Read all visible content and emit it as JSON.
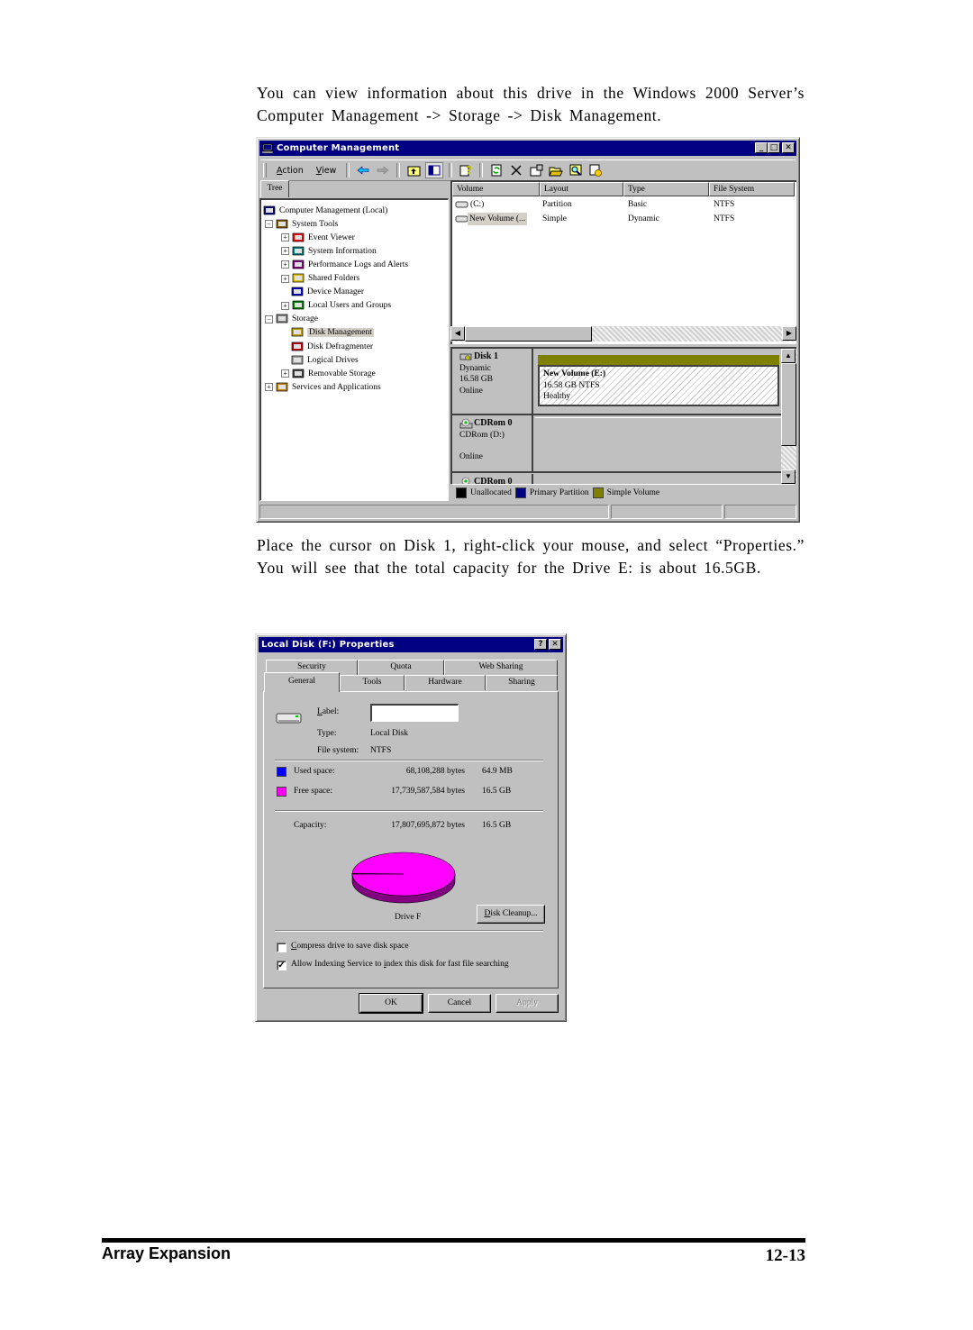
{
  "document": {
    "paragraph1": "You can view information about this drive in the Windows 2000 Server’s Computer Management -> Storage -> Disk Management.",
    "paragraph2": "Place the cursor on Disk 1, right-click your mouse, and select “Properties.” You will see that the total capacity for the Drive E: is about 16.5GB.",
    "footer": {
      "section": "Array Expansion",
      "page": "12-13"
    }
  },
  "computer_management": {
    "title": "Computer Management",
    "window_buttons": {
      "minimize": "_",
      "maximize": "□",
      "close": "✕"
    },
    "menu": {
      "action_u": "A",
      "action_rest": "ction",
      "view_u": "V",
      "view_rest": "iew"
    },
    "toolbar_icons": [
      "back-icon",
      "forward-icon",
      "up-folder-icon",
      "show-hide-tree-icon",
      "help-icon",
      "refresh-icon",
      "delete-icon",
      "properties-icon",
      "open-icon",
      "search-icon",
      "settings-icon"
    ],
    "tree_tab": "Tree",
    "tree": [
      {
        "label": "Computer Management (Local)",
        "level": 0,
        "expander": ""
      },
      {
        "label": "System Tools",
        "level": 1,
        "expander": "−"
      },
      {
        "label": "Event Viewer",
        "level": 2,
        "expander": "+"
      },
      {
        "label": "System Information",
        "level": 2,
        "expander": "+"
      },
      {
        "label": "Performance Logs and Alerts",
        "level": 2,
        "expander": "+"
      },
      {
        "label": "Shared Folders",
        "level": 2,
        "expander": "+"
      },
      {
        "label": "Device Manager",
        "level": 2,
        "expander": ""
      },
      {
        "label": "Local Users and Groups",
        "level": 2,
        "expander": "+"
      },
      {
        "label": "Storage",
        "level": 1,
        "expander": "−"
      },
      {
        "label": "Disk Management",
        "level": 2,
        "expander": "",
        "selected": true
      },
      {
        "label": "Disk Defragmenter",
        "level": 2,
        "expander": ""
      },
      {
        "label": "Logical Drives",
        "level": 2,
        "expander": ""
      },
      {
        "label": "Removable Storage",
        "level": 2,
        "expander": "+"
      },
      {
        "label": "Services and Applications",
        "level": 1,
        "expander": "+"
      }
    ],
    "volume_list": {
      "columns": [
        "Volume",
        "Layout",
        "Type",
        "File System"
      ],
      "rows": [
        {
          "volume": "(C:)",
          "layout": "Partition",
          "type": "Basic",
          "fs": "NTFS"
        },
        {
          "volume": "New Volume (...",
          "layout": "Simple",
          "type": "Dynamic",
          "fs": "NTFS"
        }
      ]
    },
    "disks": [
      {
        "name": "Disk 1",
        "kind": "Dynamic",
        "size": "16.58 GB",
        "status": "Online",
        "volume": {
          "name": "New Volume  (E:)",
          "size": "16.58 GB NTFS",
          "status": "Healthy"
        }
      },
      {
        "name": "CDRom 0",
        "kind": "CDRom (D:)",
        "size": "",
        "status": "Online"
      },
      {
        "name": "CDRom 0",
        "kind": "",
        "size": "",
        "status": ""
      }
    ],
    "legend": [
      {
        "label": "Unallocated",
        "color": "#000000"
      },
      {
        "label": "Primary Partition",
        "color": "#000080"
      },
      {
        "label": "Simple Volume",
        "color": "#808000"
      }
    ]
  },
  "properties": {
    "title": "Local Disk (F:) Properties",
    "title_buttons": {
      "help": "?",
      "close": "✕"
    },
    "tabs_back": [
      "Security",
      "Quota",
      "Web Sharing"
    ],
    "tabs_front": [
      "General",
      "Tools",
      "Hardware",
      "Sharing"
    ],
    "active_tab": "General",
    "label_caption_u": "L",
    "label_caption_rest": "abel:",
    "label_value": "",
    "type_caption": "Type:",
    "type_value": "Local Disk",
    "fs_caption": "File system:",
    "fs_value": "NTFS",
    "used": {
      "caption": "Used space:",
      "bytes": "68,108,288 bytes",
      "human": "64.9 MB",
      "color": "#0000ff"
    },
    "free": {
      "caption": "Free space:",
      "bytes": "17,739,587,584 bytes",
      "human": "16.5 GB",
      "color": "#ff00ff"
    },
    "capacity": {
      "caption": "Capacity:",
      "bytes": "17,807,695,872 bytes",
      "human": "16.5 GB"
    },
    "drive_caption": "Drive F",
    "pie": {
      "used_fraction": 0.0038,
      "free_fraction": 0.9962
    },
    "disk_cleanup_u": "D",
    "disk_cleanup_rest": "isk Cleanup...",
    "compress": {
      "u": "C",
      "rest": "ompress drive to save disk space",
      "checked": false
    },
    "indexing": {
      "pre": "Allow Indexing Service to ",
      "u": "i",
      "rest": "ndex this disk for fast file searching",
      "checked": true,
      "mark": "✓"
    },
    "buttons": {
      "ok": "OK",
      "cancel": "Cancel",
      "apply": "Apply"
    }
  }
}
